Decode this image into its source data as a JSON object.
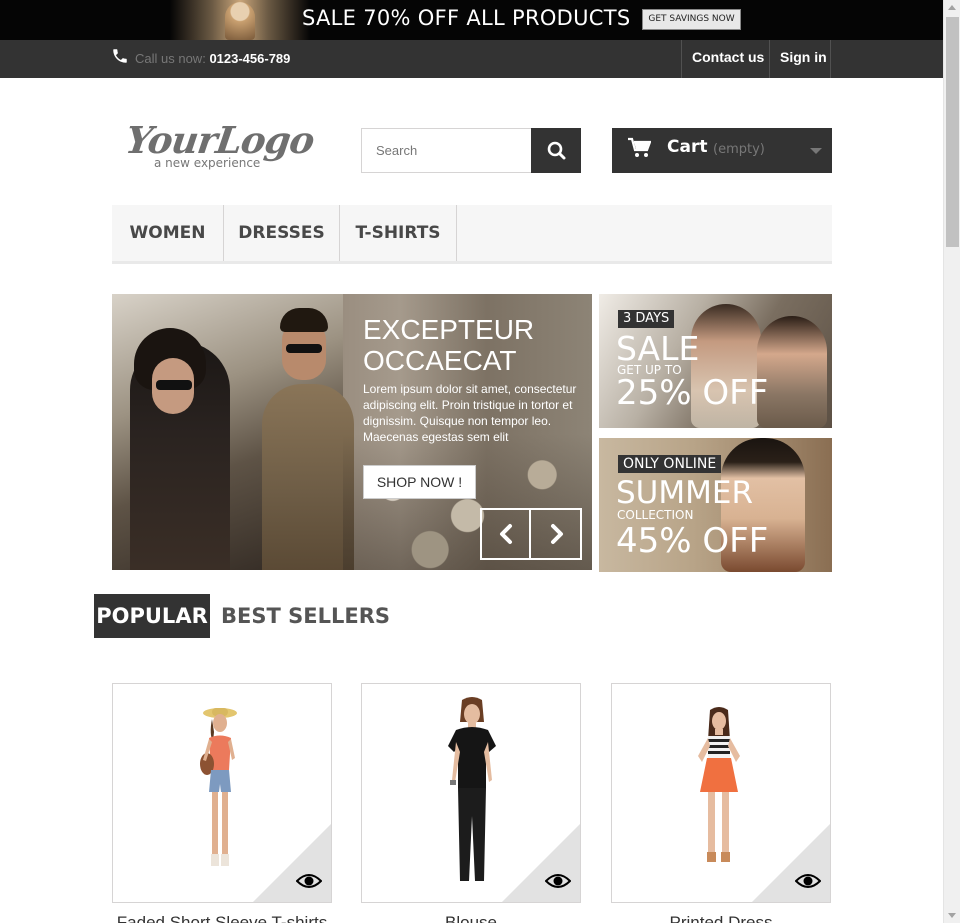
{
  "top_banner": {
    "sale_text": "SALE 70% OFF ALL PRODUCTS",
    "savings_button": "GET SAVINGS NOW"
  },
  "nav": {
    "call_label": "Call us now:",
    "call_number": "0123-456-789",
    "contact_link": "Contact us",
    "signin_link": "Sign in",
    "phone_icon": "phone-icon"
  },
  "header": {
    "logo_main": "YourLogo",
    "logo_sub": "a new experience",
    "search_placeholder": "Search",
    "search_value": "",
    "cart_label": "Cart",
    "cart_status": "(empty)"
  },
  "menu": {
    "items": [
      "WOMEN",
      "DRESSES",
      "T-SHIRTS"
    ]
  },
  "slider": {
    "title": "EXCEPTEUR OCCAECAT",
    "text": "Lorem ipsum dolor sit amet, consectetur adipiscing elit. Proin tristique in tortor et dignissim. Quisque non tempor leo. Maecenas egestas sem elit",
    "button": "SHOP NOW !"
  },
  "banners": [
    {
      "tag": "3 DAYS",
      "line1": "SALE",
      "line2": "GET UP TO",
      "line3": "25% OFF"
    },
    {
      "tag": "ONLY ONLINE",
      "line1": "SUMMER",
      "line2": "COLLECTION",
      "line3": "45% OFF"
    }
  ],
  "tabs": {
    "popular": "POPULAR",
    "best_sellers": "BEST SELLERS"
  },
  "products": [
    {
      "name": "Faded Short Sleeve T-shirts"
    },
    {
      "name": "Blouse"
    },
    {
      "name": "Printed Dress"
    }
  ],
  "colors": {
    "dark": "#333333",
    "banner_black": "#050505"
  }
}
